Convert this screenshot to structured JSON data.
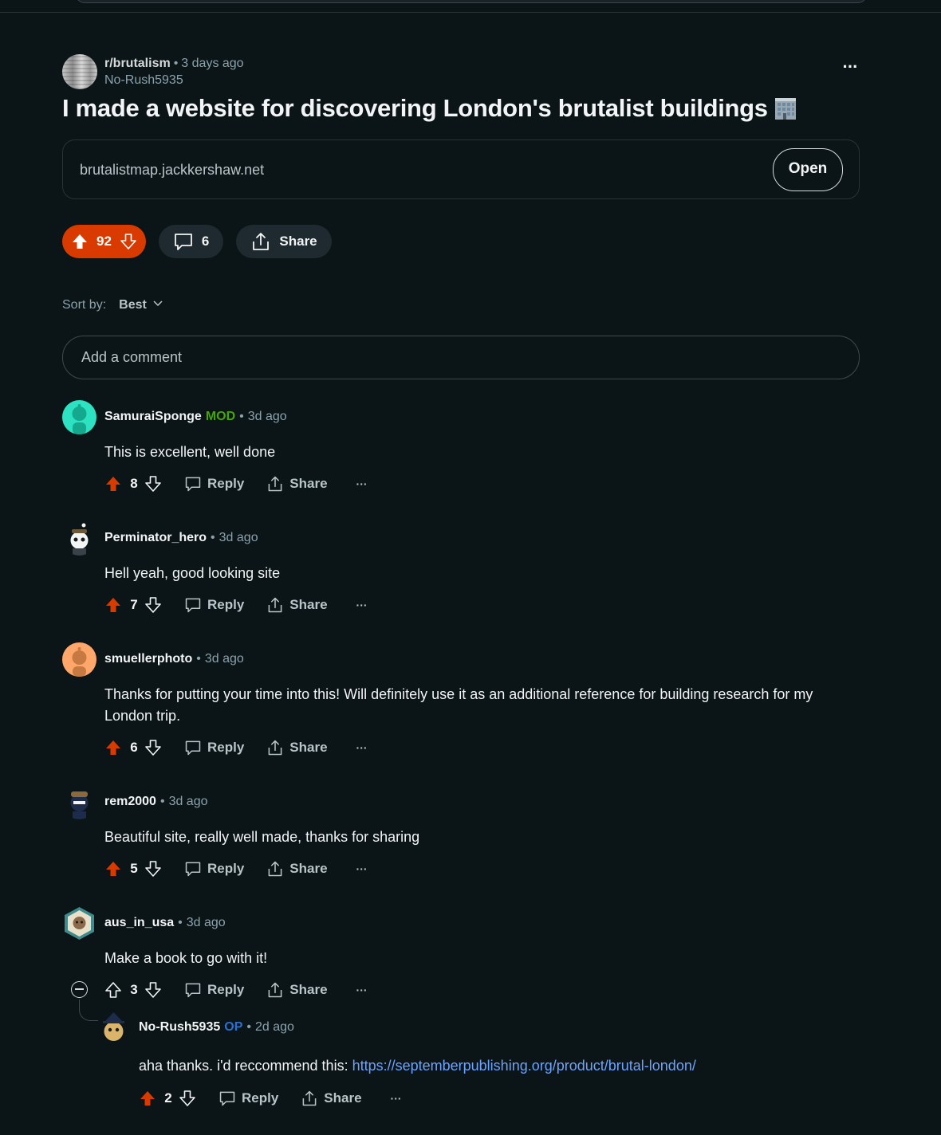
{
  "post": {
    "subreddit": "r/brutalism",
    "time": "3 days ago",
    "author": "No-Rush5935",
    "title": "I made a website for discovering London's brutalist buildings",
    "title_emoji": "office-building-icon",
    "link_url": "brutalistmap.jackkershaw.net",
    "open_label": "Open",
    "score": "92",
    "comments_count": "6",
    "share_label": "Share"
  },
  "sort": {
    "label": "Sort by:",
    "value": "Best"
  },
  "add_comment": {
    "placeholder": "Add a comment"
  },
  "comments": [
    {
      "user": "SamuraiSponge",
      "flair": "MOD",
      "time": "3d ago",
      "body": "This is excellent, well done",
      "score": "8",
      "reply": "Reply",
      "share": "Share",
      "more": "···"
    },
    {
      "user": "Perminator_hero",
      "time": "3d ago",
      "body": "Hell yeah, good looking site",
      "score": "7",
      "reply": "Reply",
      "share": "Share",
      "more": "···"
    },
    {
      "user": "smuellerphoto",
      "time": "3d ago",
      "body": "Thanks for putting your time into this! Will definitely use it as an additional reference for building research for my London trip.",
      "score": "6",
      "reply": "Reply",
      "share": "Share",
      "more": "···"
    },
    {
      "user": "rem2000",
      "time": "3d ago",
      "body": "Beautiful site, really well made, thanks for sharing",
      "score": "5",
      "reply": "Reply",
      "share": "Share",
      "more": "···"
    },
    {
      "user": "aus_in_usa",
      "time": "3d ago",
      "body": "Make a book to go with it!",
      "score": "3",
      "reply": "Reply",
      "share": "Share",
      "more": "···"
    },
    {
      "user": "No-Rush5935",
      "flair": "OP",
      "time": "2d ago",
      "body": "aha thanks. i'd reccommend this: ",
      "link": "https://septemberpublishing.org/product/brutal-london/",
      "score": "2",
      "reply": "Reply",
      "share": "Share",
      "more": "···"
    }
  ],
  "colors": {
    "background": "#0b1416",
    "upvote": "#d93a00",
    "mod": "#46a508",
    "op": "#2b6fd6",
    "link": "#6ba3ff"
  }
}
